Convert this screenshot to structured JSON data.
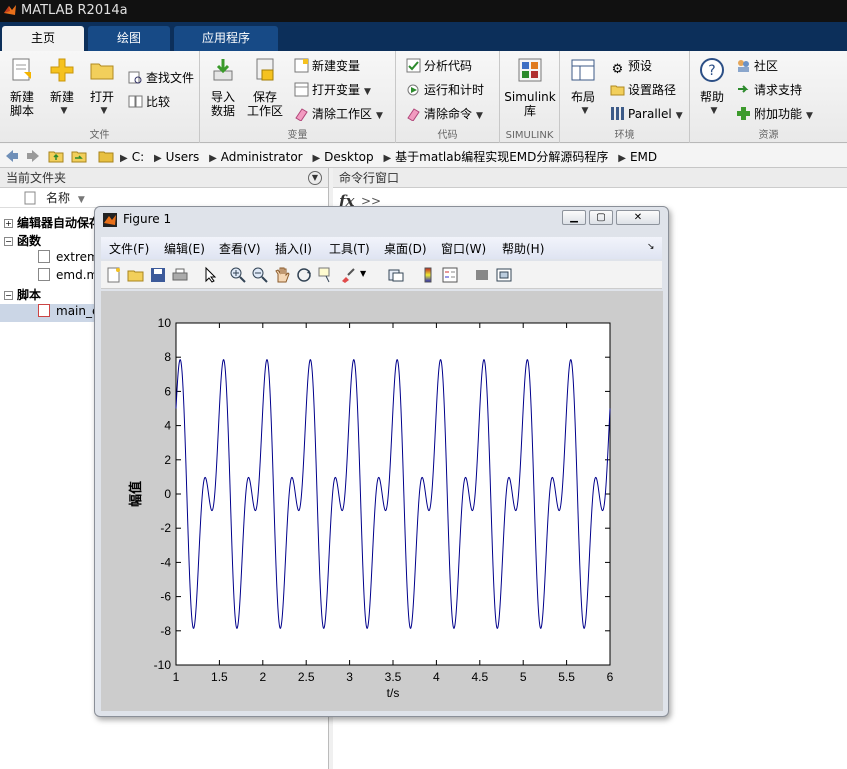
{
  "window": {
    "title": "MATLAB R2014a"
  },
  "tabs": [
    {
      "label": "主页",
      "active": true
    },
    {
      "label": "绘图",
      "active": false
    },
    {
      "label": "应用程序",
      "active": false
    }
  ],
  "ribbon": {
    "file": {
      "label": "文件",
      "new_script": "新建\n脚本",
      "new": "新建",
      "open": "打开",
      "find_files": "查找文件",
      "compare": "比较"
    },
    "variable": {
      "label": "变量",
      "import": "导入\n数据",
      "save_ws": "保存\n工作区",
      "new_var": "新建变量",
      "open_var": "打开变量",
      "clear_ws": "清除工作区"
    },
    "code": {
      "label": "代码",
      "analyze": "分析代码",
      "run_time": "运行和计时",
      "clear_cmd": "清除命令"
    },
    "simulink": {
      "label": "SIMULINK",
      "btn": "Simulink\n库"
    },
    "environment": {
      "label": "环境",
      "layout": "布局",
      "prefs": "预设",
      "set_path": "设置路径",
      "parallel": "Parallel"
    },
    "resources": {
      "label": "资源",
      "help": "帮助",
      "community": "社区",
      "support": "请求支持",
      "addons": "附加功能"
    }
  },
  "address": {
    "crumbs": [
      "C:",
      "Users",
      "Administrator",
      "Desktop",
      "基于matlab编程实现EMD分解源码程序",
      "EMD"
    ]
  },
  "current_folder": {
    "title": "当前文件夹",
    "col_name": "名称",
    "group_editor": "编辑器自动保存",
    "group_functions": "函数",
    "file_1": "extrem",
    "file_2": "emd.m",
    "group_scripts": "脚本",
    "file_3": "main_e"
  },
  "command_window": {
    "title": "命令行窗口",
    "prompt": ">>"
  },
  "figure": {
    "title": "Figure 1",
    "menus": [
      "文件(F)",
      "编辑(E)",
      "查看(V)",
      "插入(I)",
      "工具(T)",
      "桌面(D)",
      "窗口(W)",
      "帮助(H)"
    ],
    "chart_data": {
      "type": "line",
      "title": "",
      "xlabel": "t/s",
      "ylabel": "幅值",
      "xlim": [
        1,
        6
      ],
      "ylim": [
        -10,
        10
      ],
      "xticks": [
        "1",
        "1.5",
        "2",
        "2.5",
        "3",
        "3.5",
        "4",
        "4.5",
        "5",
        "5.5",
        "6"
      ],
      "yticks": [
        "-10",
        "-8",
        "-6",
        "-4",
        "-2",
        "0",
        "2",
        "4",
        "6",
        "8",
        "10"
      ],
      "grid": false,
      "series": [
        {
          "color": "#00008b",
          "x_start": 1,
          "x_end": 6,
          "formula": "y = 4*sin(2*pi*4*t) + 5*cos(2*pi*2*t)"
        }
      ]
    }
  }
}
